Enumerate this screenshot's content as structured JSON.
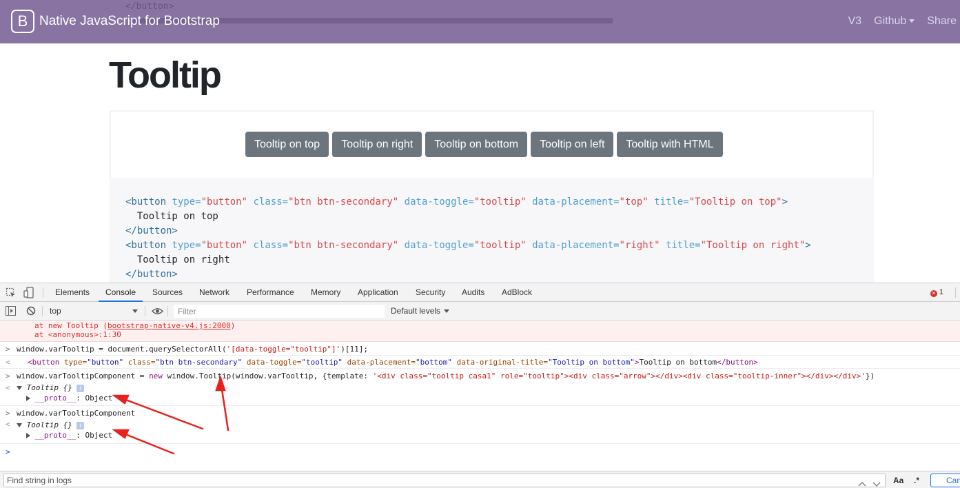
{
  "navbar": {
    "ghost_text": "</button>",
    "brand_logo": "B",
    "brand_text": "Native JavaScript for Bootstrap",
    "links": [
      "V3",
      "Github",
      "Share"
    ]
  },
  "page": {
    "title": "Tooltip",
    "buttons": [
      "Tooltip on top",
      "Tooltip on right",
      "Tooltip on bottom",
      "Tooltip on left",
      "Tooltip with HTML"
    ],
    "code": {
      "tag_open": "<button",
      "attr_type": "type=",
      "val_type": "\"button\"",
      "attr_class": "class=",
      "val_class": "\"btn btn-secondary\"",
      "attr_toggle": "data-toggle=",
      "val_toggle": "\"tooltip\"",
      "attr_placement": "data-placement=",
      "attr_title": "title=",
      "tag_close_bracket": ">",
      "tag_close": "</button>",
      "line1_placement": "\"top\"",
      "line1_title": "\"Tooltip on top\"",
      "line2_text": "  Tooltip on top",
      "line4_placement": "\"right\"",
      "line4_title": "\"Tooltip on right\"",
      "line5_text": "  Tooltip on right"
    }
  },
  "devtools": {
    "tabs": [
      "Elements",
      "Console",
      "Sources",
      "Network",
      "Performance",
      "Memory",
      "Application",
      "Security",
      "Audits",
      "AdBlock"
    ],
    "active_tab": "Console",
    "error_count": "1",
    "context": "top",
    "filter_placeholder": "Filter",
    "levels": "Default levels",
    "console": {
      "err_line1_pre": "at new Tooltip (",
      "err_line1_link": "bootstrap-native-v4.js:2000",
      "err_line1_post": ")",
      "err_line2": "at <anonymous>:1:30",
      "in1_pre": "window.varTooltip = document.querySelectorAll(",
      "in1_str": "'[data-toggle=\"tooltip\"]'",
      "in1_post": ")[11];",
      "out1": {
        "open": "<button",
        "a1": " type=",
        "v1": "\"button\"",
        "a2": " class=",
        "v2": "\"btn btn-secondary\"",
        "a3": " data-toggle=",
        "v3": "\"tooltip\"",
        "a4": " data-placement=",
        "v4": "\"bottom\"",
        "a5": " data-original-title=",
        "v5": "\"Tooltip on bottom\"",
        "close": ">",
        "text": "Tooltip on bottom",
        "end": "</button>"
      },
      "in2_pre": "window.varTooltipComponent = ",
      "in2_kw": "new",
      "in2_mid": " window.Tooltip(window.varTooltip, {template: ",
      "in2_str": "'<div class=\"tooltip casa1\" role=\"tooltip\"><div class=\"arrow\"></div><div class=\"tooltip-inner\"></div></div>'",
      "in2_post": "})",
      "obj_label": "Tooltip {}",
      "info_badge": "i",
      "proto_key": "__proto__",
      "proto_sep": ": ",
      "proto_val": "Object",
      "in3": "window.varTooltipComponent",
      "marker_input": ">",
      "marker_output": "<"
    },
    "search": {
      "placeholder": "Find string in logs",
      "case_label": "Aa",
      "regex_label": ".*",
      "cancel_label": "Cancel"
    }
  },
  "colors": {
    "navbar": "#8873a3",
    "button": "#6c757d",
    "annotation_arrow": "#e8211d",
    "devtools_accent": "#1a73e8"
  },
  "icons": [
    "bootstrap-logo-icon",
    "inspect-element-icon",
    "device-toolbar-icon",
    "sidebar-toggle-icon",
    "clear-console-icon",
    "eye-icon",
    "error-icon",
    "expand-triangle-icon",
    "collapse-triangle-icon",
    "search-up-icon",
    "search-down-icon",
    "annotation-arrow"
  ]
}
